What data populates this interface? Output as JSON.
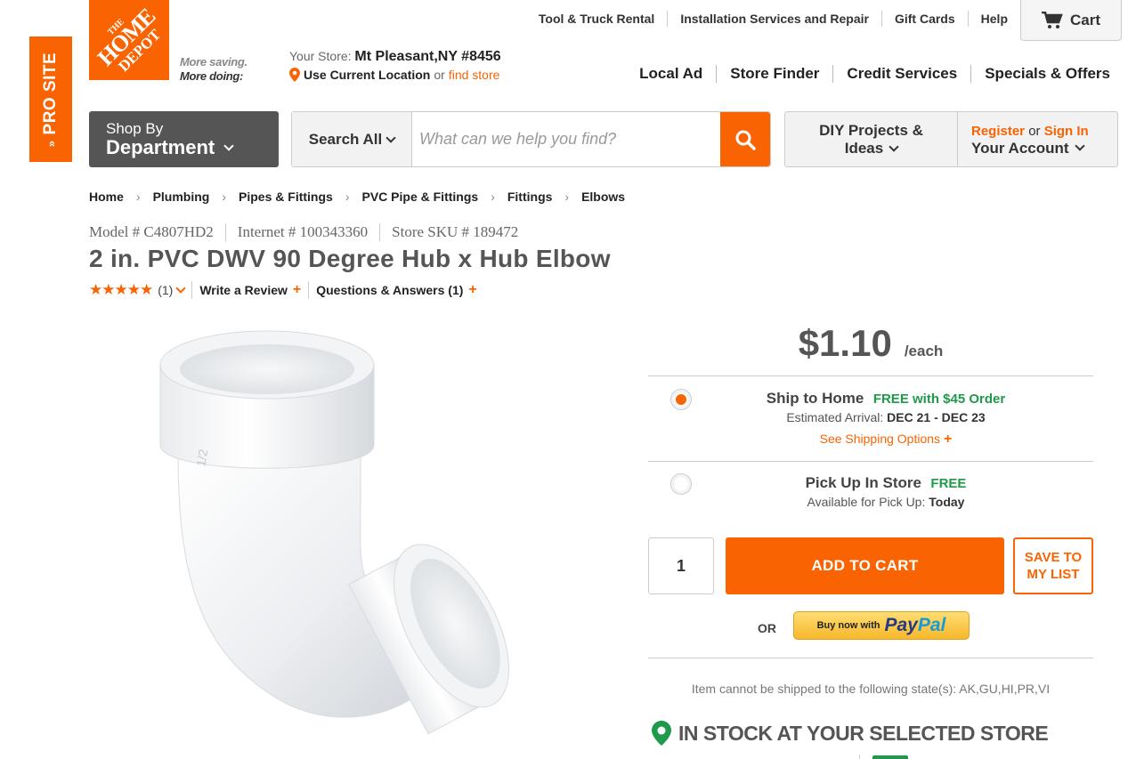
{
  "pro_site": {
    "label": "PRO SITE"
  },
  "logo": {
    "line1": "THE",
    "line2": "HOME",
    "line3": "DEPOT"
  },
  "tagline": {
    "line1": "More saving.",
    "line2": "More doing:"
  },
  "util_nav": [
    "Tool & Truck Rental",
    "Installation Services and Repair",
    "Gift Cards",
    "Help"
  ],
  "cart": {
    "label": "Cart"
  },
  "store": {
    "your_store_label": "Your Store:",
    "name": "Mt Pleasant,NY #8456",
    "use_location": "Use Current Location",
    "or": "or",
    "find_store": "find store"
  },
  "main_nav": [
    "Local Ad",
    "Store Finder",
    "Credit Services",
    "Specials & Offers"
  ],
  "shop_dept": {
    "line1": "Shop By",
    "line2": "Department"
  },
  "search": {
    "scope": "Search All",
    "placeholder": "What can we help you find?"
  },
  "diy": {
    "line1": "DIY Projects &",
    "line2": "Ideas"
  },
  "account": {
    "register": "Register",
    "or": "or",
    "sign_in": "Sign In",
    "line2": "Your Account"
  },
  "breadcrumb": [
    "Home",
    "Plumbing",
    "Pipes & Fittings",
    "PVC Pipe & Fittings",
    "Fittings",
    "Elbows"
  ],
  "product": {
    "model": "Model # C4807HD2",
    "internet": "Internet # 100343360",
    "sku": "Store SKU # 189472",
    "title": "2 in. PVC DWV 90 Degree Hub x Hub Elbow",
    "stars": "★★★★★",
    "rating_count": "(1)",
    "write_review": "Write a Review",
    "qa": "Questions & Answers (1)",
    "image_alt": "white PVC 90 degree elbow fitting"
  },
  "pricing": {
    "amount": "$1.10",
    "unit": "/each"
  },
  "ship_to_home": {
    "title": "Ship to Home",
    "free": "FREE with $45 Order",
    "arrival_label": "Estimated Arrival:",
    "arrival": "DEC 21 - DEC 23",
    "options_link": "See Shipping Options",
    "selected": true
  },
  "pickup": {
    "title": "Pick Up In Store",
    "free": "FREE",
    "avail_label": "Available for Pick Up:",
    "avail": "Today",
    "selected": false
  },
  "cart_actions": {
    "quantity": "1",
    "add_to_cart": "ADD TO CART",
    "save_line1": "SAVE TO",
    "save_line2": "MY LIST",
    "or": "OR",
    "paypal_prefix": "Buy now with",
    "paypal_pay": "Pay",
    "paypal_pal": "Pal"
  },
  "no_ship": "Item cannot be shipped to the following state(s): AK,GU,HI,PR,VI",
  "in_stock": "IN STOCK AT YOUR SELECTED STORE",
  "colors": {
    "brand": "#f96302",
    "green": "#1e9a4a",
    "dark": "#333333"
  }
}
